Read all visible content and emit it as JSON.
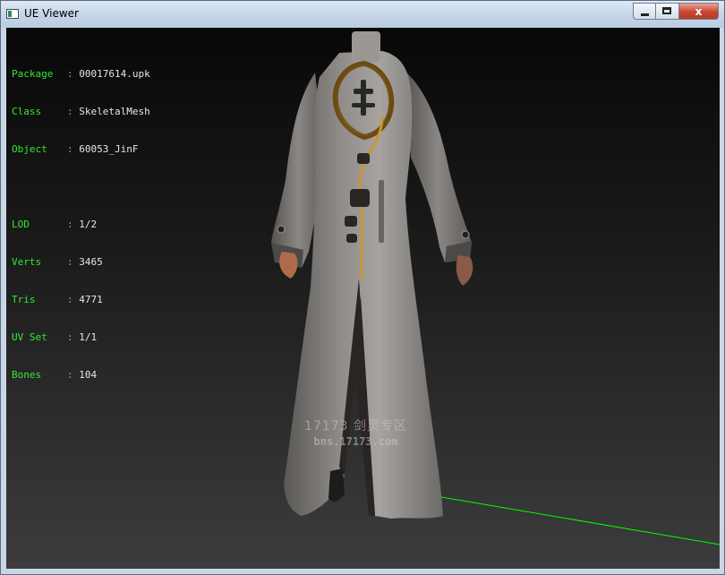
{
  "window": {
    "title": "UE Viewer",
    "minimize_label": "",
    "maximize_label": "",
    "close_label": "x"
  },
  "info": {
    "rows": [
      {
        "label": "Package",
        "value": "00017614.upk"
      },
      {
        "label": "Class",
        "value": "SkeletalMesh"
      },
      {
        "label": "Object",
        "value": "60053_JinF"
      },
      {
        "label": "LOD",
        "value": "1/2"
      },
      {
        "label": "Verts",
        "value": "3465"
      },
      {
        "label": "Tris",
        "value": "4771"
      },
      {
        "label": "UV Set",
        "value": "1/1"
      },
      {
        "label": "Bones",
        "value": "104"
      }
    ]
  },
  "watermark": {
    "line1": "17173 剑灵专区",
    "line2": "bns.17173.com"
  },
  "colors": {
    "label_green": "#33e833",
    "value_white": "#e6e6e6",
    "axis_x": "#00ff00",
    "axis_y": "#ff2020",
    "axis_z": "#2040ff"
  }
}
